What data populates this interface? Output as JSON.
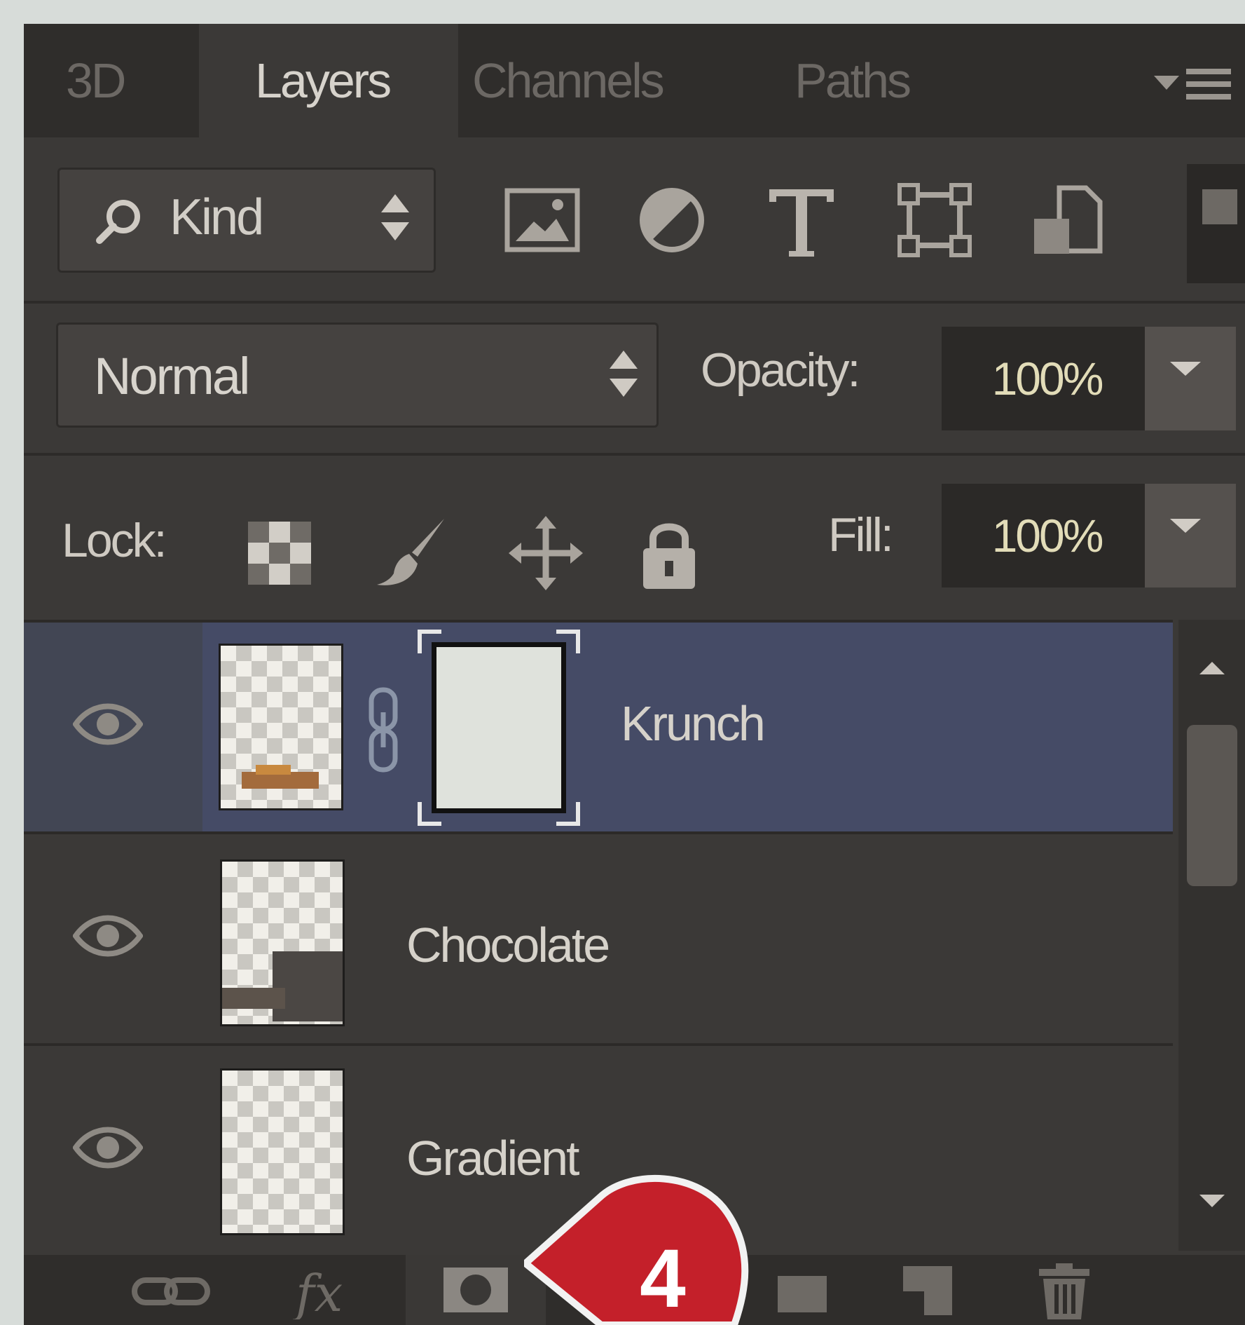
{
  "tabs": [
    {
      "label": "3D",
      "active": false
    },
    {
      "label": "Layers",
      "active": true
    },
    {
      "label": "Channels",
      "active": false
    },
    {
      "label": "Paths",
      "active": false
    }
  ],
  "filter": {
    "kind_label": "Kind",
    "filter_icons": [
      "image-filter-icon",
      "adjustment-filter-icon",
      "type-filter-icon",
      "shape-filter-icon",
      "smart-object-filter-icon"
    ]
  },
  "blend": {
    "mode": "Normal",
    "opacity_label": "Opacity:",
    "opacity_value": "100%"
  },
  "lock": {
    "label": "Lock:",
    "fill_label": "Fill:",
    "fill_value": "100%"
  },
  "layers": [
    {
      "name": "Krunch",
      "selected": true,
      "has_mask": true,
      "visible": true
    },
    {
      "name": "Chocolate",
      "selected": false,
      "has_mask": false,
      "visible": true
    },
    {
      "name": "Gradient",
      "selected": false,
      "has_mask": false,
      "visible": true
    }
  ],
  "bottom_toolbar": [
    "link-layers-icon",
    "fx-icon",
    "add-mask-icon",
    "new-group-icon",
    "new-layer-icon",
    "trash-icon"
  ],
  "callout": {
    "number": "4",
    "color": "#c4202a"
  },
  "colors": {
    "panel_bg": "#3b3937",
    "selected_row": "#454b66"
  }
}
